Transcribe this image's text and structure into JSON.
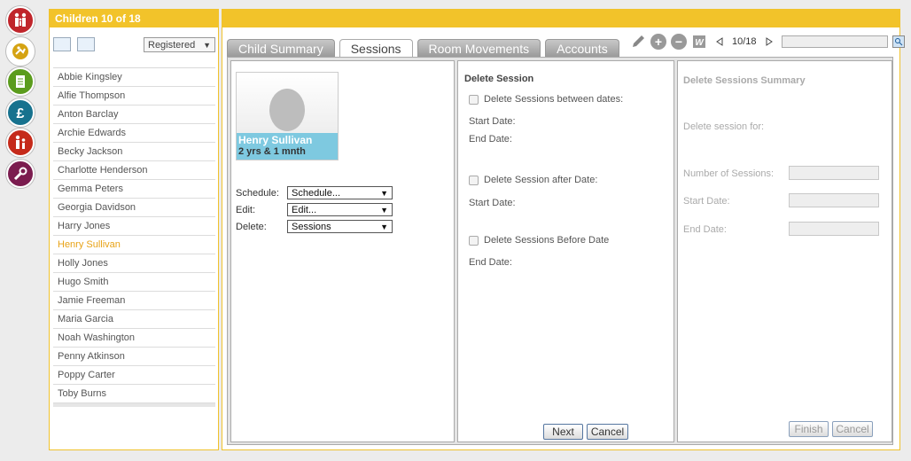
{
  "rail": {
    "items": [
      {
        "name": "children-nav-icon",
        "color": "#c0252b"
      },
      {
        "name": "activity-nav-icon",
        "color": "#d5a313"
      },
      {
        "name": "register-nav-icon",
        "color": "#5b9c1d"
      },
      {
        "name": "finance-nav-icon",
        "color": "#17728e"
      },
      {
        "name": "staff-nav-icon",
        "color": "#c52a1a"
      },
      {
        "name": "settings-nav-icon",
        "color": "#7b1c4f"
      }
    ]
  },
  "children_panel": {
    "title": "Children 10 of 18",
    "filter": "Registered",
    "children": [
      "Abbie Kingsley",
      "Alfie Thompson",
      "Anton Barclay",
      "Archie Edwards",
      "Becky Jackson",
      "Charlotte Henderson",
      "Gemma Peters",
      "Georgia Davidson",
      "Harry Jones",
      "Henry Sullivan",
      "Holly Jones",
      "Hugo Smith",
      "Jamie Freeman",
      "Maria Garcia",
      "Noah Washington",
      "Penny Atkinson",
      "Poppy Carter",
      "Toby Burns"
    ],
    "selected": "Henry Sullivan"
  },
  "tabs": [
    "Child Summary",
    "Sessions",
    "Room Movements",
    "Accounts"
  ],
  "active_tab": "Sessions",
  "toolbar": {
    "page_count": "10/18"
  },
  "child_card": {
    "name": "Henry Sullivan",
    "age": "2 yrs & 1 mnth"
  },
  "actions": {
    "schedule_label": "Schedule:",
    "schedule_value": "Schedule...",
    "edit_label": "Edit:",
    "edit_value": "Edit...",
    "delete_label": "Delete:",
    "delete_value": "Sessions"
  },
  "delete_session": {
    "title": "Delete Session",
    "between_dates": "Delete Sessions between dates:",
    "start_date_1": "Start Date:",
    "end_date_1": "End Date:",
    "after_date": "Delete Session after Date:",
    "start_date_2": "Start Date:",
    "before_date": "Delete Sessions Before Date",
    "end_date_2": "End Date:",
    "next_button": "Next",
    "cancel_button": "Cancel"
  },
  "summary": {
    "title": "Delete Sessions Summary",
    "delete_for": "Delete session for:",
    "num_sessions": "Number of Sessions:",
    "start_date": "Start Date:",
    "end_date": "End Date:",
    "finish_button": "Finish",
    "cancel_button": "Cancel"
  }
}
